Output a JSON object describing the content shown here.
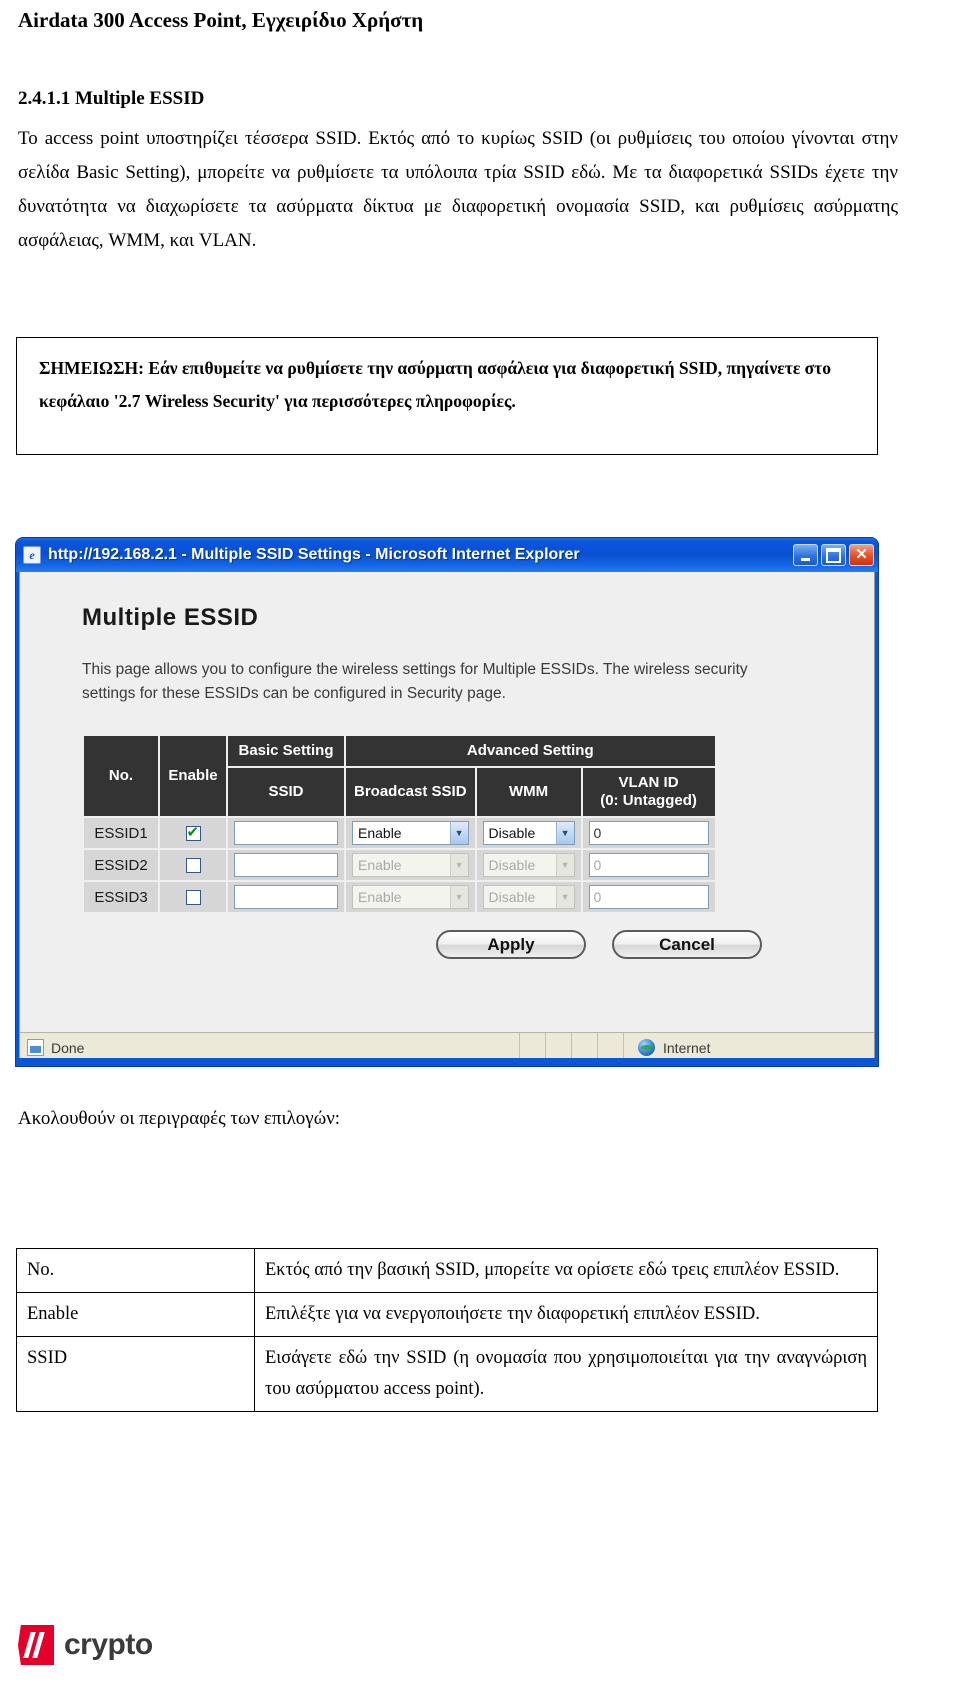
{
  "document": {
    "header": "Airdata 300 Access Point, Εγχειρίδιο Χρήστη",
    "section_number_title": "2.4.1.1 Multiple ESSID",
    "paragraph": "Το access point υποστηρίζει τέσσερα SSID. Εκτός από το κυρίως SSID (οι ρυθμίσεις του οποίου γίνονται στην σελίδα Basic Setting), μπορείτε να ρυθμίσετε τα υπόλοιπα τρία SSID εδώ. Με τα διαφορετικά SSIDs έχετε την δυνατότητα να διαχωρίσετε τα ασύρματα δίκτυα με διαφορετική ονομασία SSID, και ρυθμίσεις ασύρματης ασφάλειας, WMM, και VLAN.",
    "note": "ΣΗΜΕΙΩΣΗ: Εάν επιθυμείτε να ρυθμίσετε την ασύρματη ασφάλεια για διαφορετική SSID, πηγαίνετε στο κεφάλαιο '2.7 Wireless Security' για περισσότερες πληροφορίες.",
    "caption_after_figure": "Ακολουθούν οι περιγραφές των επιλογών:",
    "footer_logo_text": "crypto"
  },
  "browser": {
    "title": "http://192.168.2.1 - Multiple SSID Settings - Microsoft Internet Explorer",
    "app_icon": "e",
    "minimize_label": "_",
    "maximize_label": "□",
    "close_label": "✕",
    "status_left": "Done",
    "status_right": "Internet"
  },
  "page": {
    "title": "Multiple ESSID",
    "description": "This page allows you to configure the wireless settings for Multiple ESSIDs. The wireless security settings for these ESSIDs can be configured in Security page.",
    "table": {
      "group_headers": {
        "basic": "Basic Setting",
        "advanced": "Advanced Setting"
      },
      "columns": {
        "no": "No.",
        "enable": "Enable",
        "ssid": "SSID",
        "broadcast_ssid": "Broadcast SSID",
        "wmm": "WMM",
        "vlan_id_line1": "VLAN ID",
        "vlan_id_line2": "(0: Untagged)"
      },
      "rows": [
        {
          "no": "ESSID1",
          "enabled": true,
          "ssid": "",
          "broadcast_ssid": "Enable",
          "wmm": "Disable",
          "vlan_id": "0",
          "dimmed": false
        },
        {
          "no": "ESSID2",
          "enabled": false,
          "ssid": "",
          "broadcast_ssid": "Enable",
          "wmm": "Disable",
          "vlan_id": "0",
          "dimmed": true
        },
        {
          "no": "ESSID3",
          "enabled": false,
          "ssid": "",
          "broadcast_ssid": "Enable",
          "wmm": "Disable",
          "vlan_id": "0",
          "dimmed": true
        }
      ]
    },
    "buttons": {
      "apply": "Apply",
      "cancel": "Cancel"
    }
  },
  "descriptions": {
    "rows": [
      {
        "key": "No.",
        "value": "Εκτός από την βασική SSID, μπορείτε να ορίσετε εδώ τρεις επιπλέον ESSID."
      },
      {
        "key": "Enable",
        "value": "Επιλέξτε για να ενεργοποιήσετε την διαφορετική επιπλέον ESSID."
      },
      {
        "key": "SSID",
        "value": "Εισάγετε εδώ την SSID (η ονομασία που χρησιμοποιείται για την αναγνώριση του ασύρματου access point)."
      }
    ]
  },
  "colors": {
    "titlebar_blue": "#0a56d6",
    "table_header_dark": "#333333",
    "page_bg": "#efefef",
    "status_bar": "#ece9d8",
    "logo_red": "#e4002b",
    "check_green": "#0a8a2a"
  }
}
